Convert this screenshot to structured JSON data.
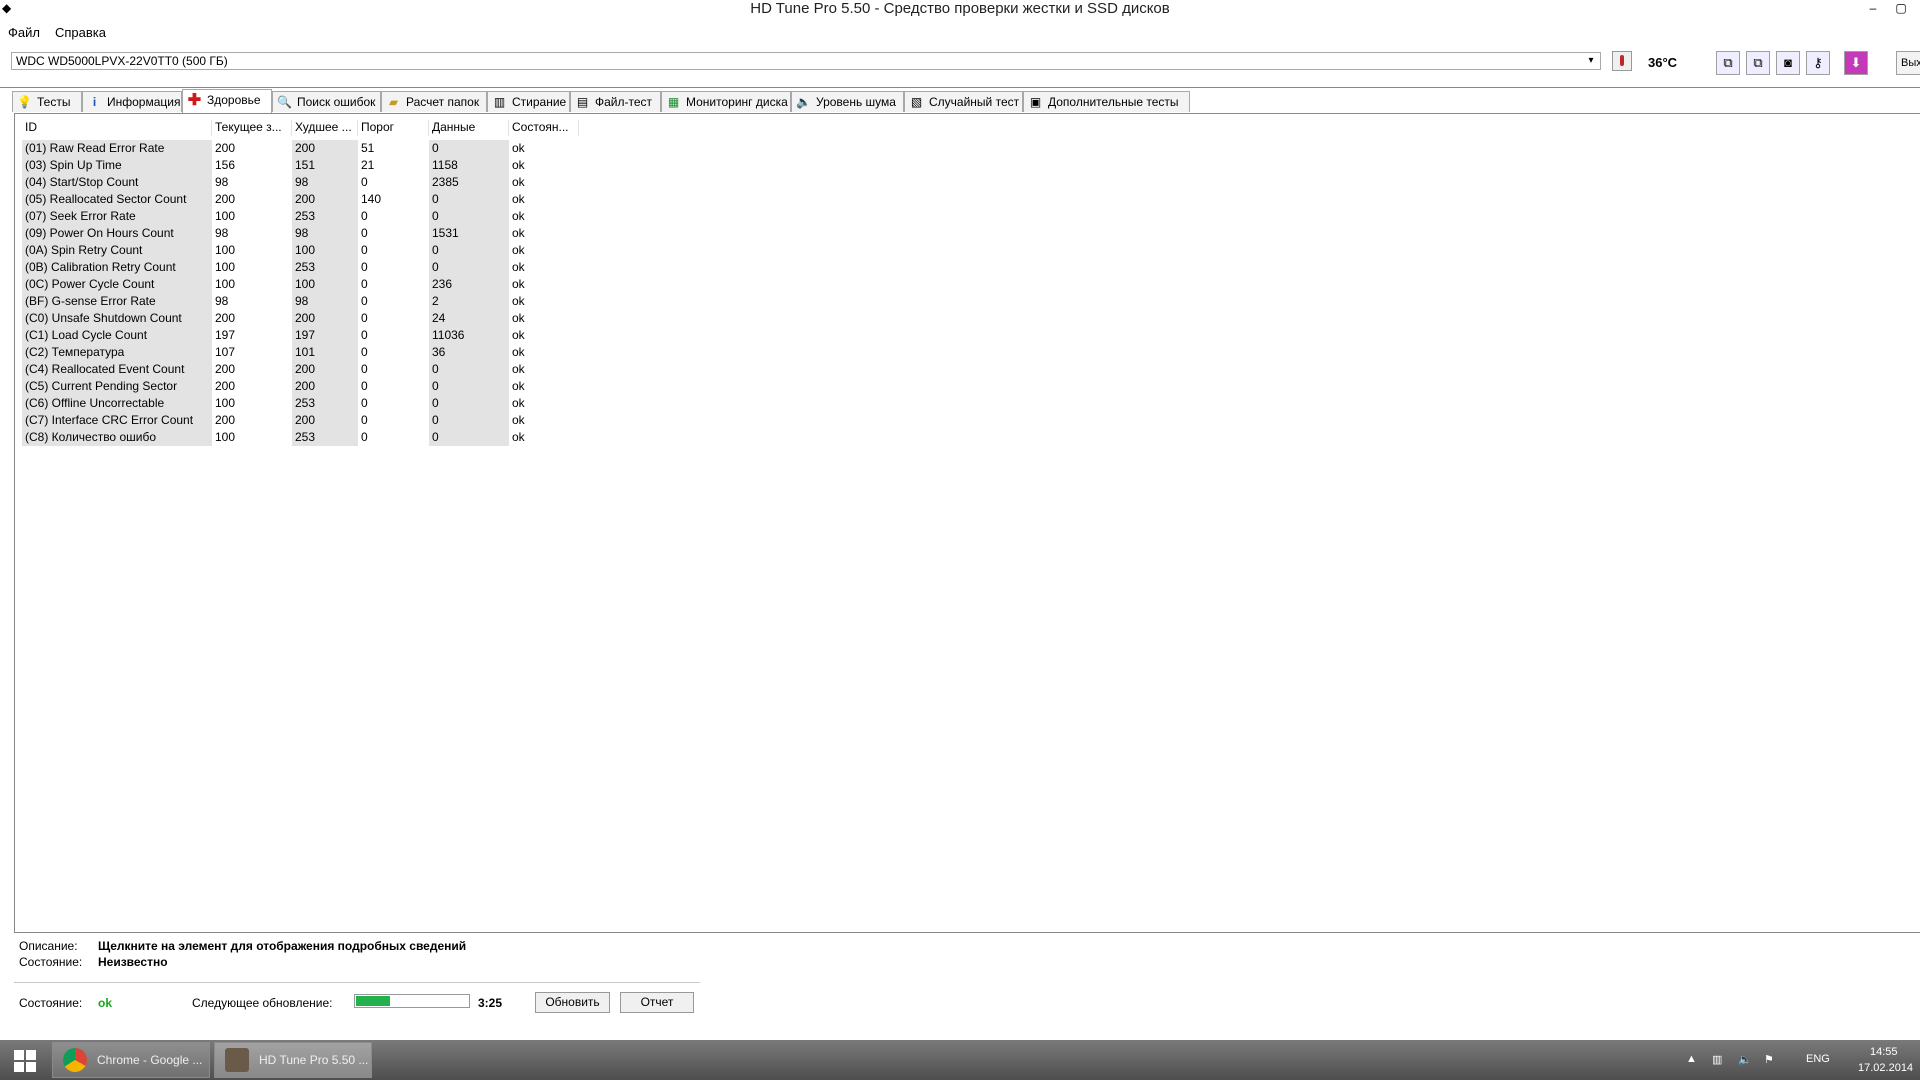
{
  "window": {
    "title": "HD Tune Pro 5.50 - Средство проверки жестки и SSD дисков",
    "minimize": "–",
    "maximize": "▢"
  },
  "menu": {
    "file": "Файл",
    "help": "Справка"
  },
  "toolbar": {
    "drive": "WDC WD5000LPVX-22V0TT0 (500 ГБ)",
    "temperature": "36°C",
    "exit_label": "Вых"
  },
  "tabs": [
    {
      "label": "Тесты",
      "icon": "bulb-icon"
    },
    {
      "label": "Информация",
      "icon": "info-icon"
    },
    {
      "label": "Здоровье",
      "icon": "health-cross-icon"
    },
    {
      "label": "Поиск ошибок",
      "icon": "magnifier-icon"
    },
    {
      "label": "Расчет папок",
      "icon": "folder-icon"
    },
    {
      "label": "Стирание",
      "icon": "trash-icon"
    },
    {
      "label": "Файл-тест",
      "icon": "file-icon"
    },
    {
      "label": "Мониторинг диска",
      "icon": "monitor-icon"
    },
    {
      "label": "Уровень шума",
      "icon": "speaker-icon"
    },
    {
      "label": "Случайный тест",
      "icon": "random-icon"
    },
    {
      "label": "Дополнительные тесты",
      "icon": "extra-icon"
    }
  ],
  "smart": {
    "columns": [
      "ID",
      "Текущее з...",
      "Худшее ...",
      "Порог",
      "Данные",
      "Состоян..."
    ],
    "rows": [
      [
        "(01) Raw Read Error Rate",
        "200",
        "200",
        "51",
        "0",
        "ok"
      ],
      [
        "(03) Spin Up Time",
        "156",
        "151",
        "21",
        "1158",
        "ok"
      ],
      [
        "(04) Start/Stop Count",
        "98",
        "98",
        "0",
        "2385",
        "ok"
      ],
      [
        "(05) Reallocated Sector Count",
        "200",
        "200",
        "140",
        "0",
        "ok"
      ],
      [
        "(07) Seek Error Rate",
        "100",
        "253",
        "0",
        "0",
        "ok"
      ],
      [
        "(09) Power On Hours Count",
        "98",
        "98",
        "0",
        "1531",
        "ok"
      ],
      [
        "(0A) Spin Retry Count",
        "100",
        "100",
        "0",
        "0",
        "ok"
      ],
      [
        "(0B) Calibration Retry Count",
        "100",
        "253",
        "0",
        "0",
        "ok"
      ],
      [
        "(0C) Power Cycle Count",
        "100",
        "100",
        "0",
        "236",
        "ok"
      ],
      [
        "(BF) G-sense Error Rate",
        "98",
        "98",
        "0",
        "2",
        "ok"
      ],
      [
        "(C0) Unsafe Shutdown Count",
        "200",
        "200",
        "0",
        "24",
        "ok"
      ],
      [
        "(C1) Load Cycle Count",
        "197",
        "197",
        "0",
        "11036",
        "ok"
      ],
      [
        "(C2) Температура",
        "107",
        "101",
        "0",
        "36",
        "ok"
      ],
      [
        "(C4) Reallocated Event Count",
        "200",
        "200",
        "0",
        "0",
        "ok"
      ],
      [
        "(C5) Current Pending Sector",
        "200",
        "200",
        "0",
        "0",
        "ok"
      ],
      [
        "(C6) Offline Uncorrectable",
        "100",
        "253",
        "0",
        "0",
        "ok"
      ],
      [
        "(C7) Interface CRC Error Count",
        "200",
        "200",
        "0",
        "0",
        "ok"
      ],
      [
        "(C8) Количество ошибо",
        "100",
        "253",
        "0",
        "0",
        "ok"
      ]
    ]
  },
  "details": {
    "description_label": "Описание:",
    "description_value": "Щелкните на элемент для отображения подробных сведений",
    "state_label": "Состояние:",
    "state_value": "Неизвестно"
  },
  "status": {
    "label": "Состояние:",
    "value": "ok",
    "value_color": "#1aa81a",
    "next_update_label": "Следующее обновление:",
    "progress_fraction": 0.3,
    "progress_color": "#22b14c",
    "timer": "3:25",
    "refresh_button": "Обновить",
    "report_button": "Отчет"
  },
  "taskbar": {
    "tasks": [
      {
        "label": "Chrome - Google ...",
        "icon": "chrome-icon"
      },
      {
        "label": "HD Tune Pro 5.50 ...",
        "icon": "hdtune-icon"
      }
    ],
    "language": "ENG",
    "time": "14:55",
    "date": "17.02.2014"
  }
}
